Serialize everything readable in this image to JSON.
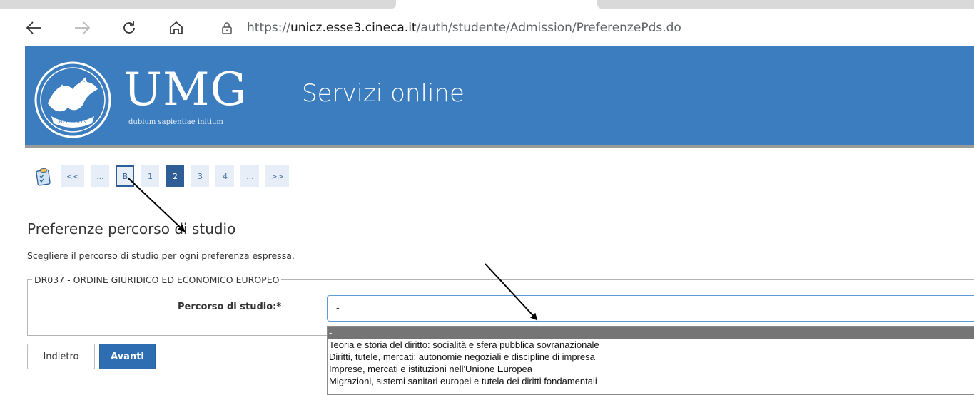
{
  "browser": {
    "url_host": "unicz.esse3.cineca.it",
    "url_path": "/auth/studente/Admission/PreferenzePds.do",
    "url_scheme": "https://",
    "icons": [
      "back-arrow-icon",
      "forward-arrow-icon",
      "reload-icon",
      "home-icon",
      "lock-icon"
    ]
  },
  "header": {
    "logo_text": "UMG",
    "motto": "dubium sapientiae initium",
    "seal_text": "BPETTIΩN",
    "service_title": "Servizi online",
    "bg_color": "#3b7dbf"
  },
  "steps": {
    "items": [
      "<<",
      "...",
      "B",
      "1",
      "2",
      "3",
      "4",
      "...",
      ">>"
    ],
    "active": "2",
    "highlighted": "B"
  },
  "main": {
    "title": "Preferenze percorso di studio",
    "description": "Scegliere il percorso di studio per ogni preferenza espressa.",
    "fieldset_legend": "DR037 - ORDINE GIURIDICO ED ECONOMICO EUROPEO",
    "field_label": "Percorso di studio:*",
    "field_value": "-",
    "options": [
      "-",
      "Teoria e storia del diritto: socialità e sfera pubblica sovranazionale",
      "Diritti, tutele, mercati: autonomie negoziali e discipline di impresa",
      "Imprese, mercati e istituzioni nell'Unione Europea",
      "Migrazioni, sistemi sanitari europei e tutela dei diritti fondamentali"
    ],
    "selected_option_index": 0
  },
  "buttons": {
    "back_label": "Indietro",
    "next_label": "Avanti",
    "accent": "#2f6db3"
  }
}
